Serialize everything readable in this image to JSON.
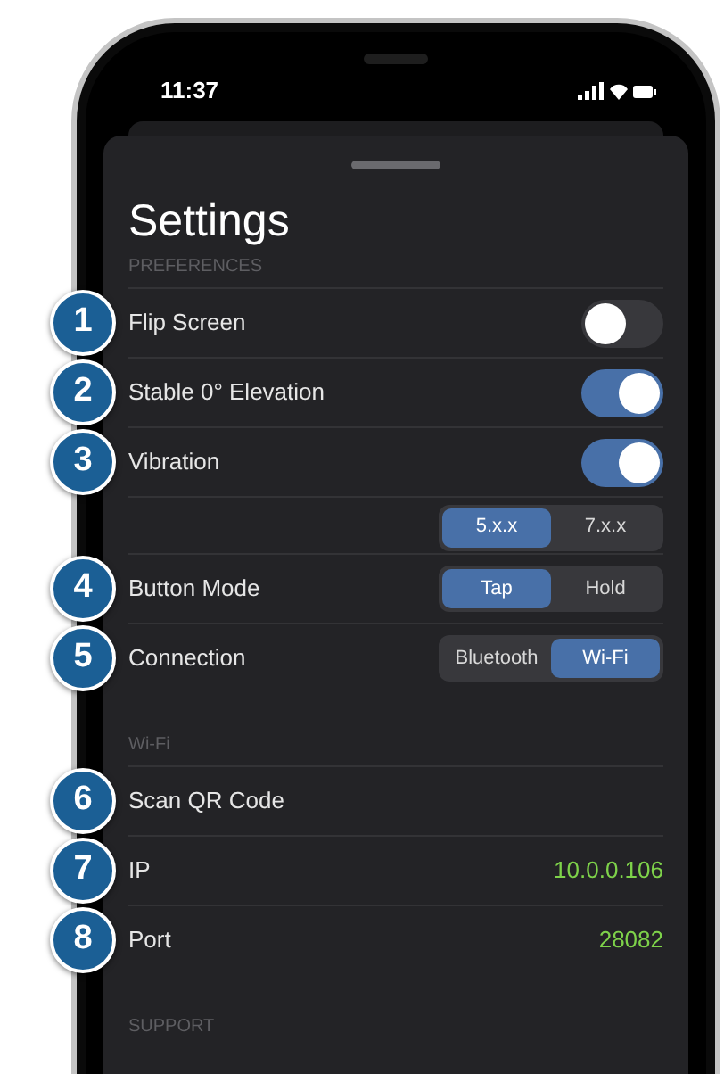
{
  "status_bar": {
    "time": "11:37"
  },
  "sheet": {
    "title": "Settings",
    "sections": [
      {
        "header": "PREFERENCES",
        "rows": [
          {
            "badge": "1",
            "label": "Flip Screen",
            "kind": "toggle",
            "on": false
          },
          {
            "badge": "2",
            "label": "Stable 0° Elevation",
            "kind": "toggle",
            "on": true
          },
          {
            "badge": "3",
            "label": "Vibration",
            "kind": "toggle",
            "on": true
          },
          {
            "kind": "segmented",
            "options": [
              {
                "label": "5.x.x",
                "selected": true
              },
              {
                "label": "7.x.x",
                "selected": false
              }
            ]
          },
          {
            "badge": "4",
            "label": "Button Mode",
            "kind": "segmented",
            "options": [
              {
                "label": "Tap",
                "selected": true
              },
              {
                "label": "Hold",
                "selected": false
              }
            ]
          },
          {
            "badge": "5",
            "label": "Connection",
            "kind": "segmented",
            "options": [
              {
                "label": "Bluetooth",
                "selected": false
              },
              {
                "label": "Wi-Fi",
                "selected": true
              }
            ]
          }
        ]
      },
      {
        "header": "Wi-Fi",
        "rows": [
          {
            "badge": "6",
            "label": "Scan QR Code",
            "kind": "plain"
          },
          {
            "badge": "7",
            "label": "IP",
            "kind": "value",
            "value": "10.0.0.106"
          },
          {
            "badge": "8",
            "label": "Port",
            "kind": "value",
            "value": "28082"
          }
        ]
      },
      {
        "header": "SUPPORT"
      }
    ]
  }
}
